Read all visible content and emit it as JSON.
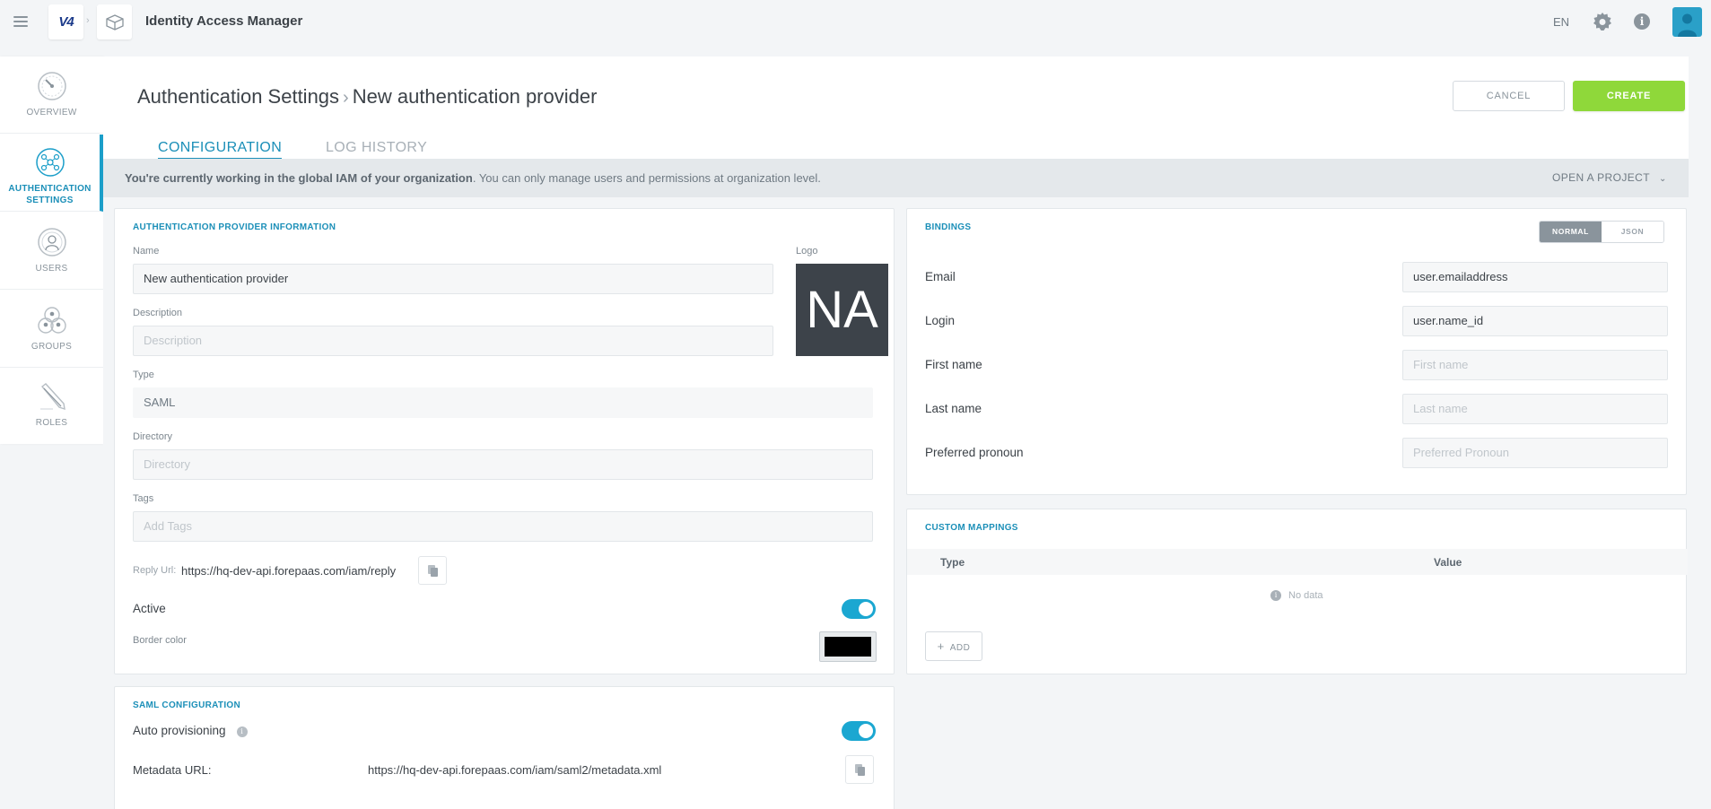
{
  "app": {
    "title": "Identity Access Manager",
    "brand": "V4",
    "lang": "EN",
    "colors": {
      "accent": "#1b8fb8",
      "create": "#8fd83a",
      "toggle": "#1ba7d1"
    }
  },
  "sidebar": {
    "items": [
      {
        "label": "OVERVIEW",
        "icon": "dashboard-icon"
      },
      {
        "label": "AUTHENTICATION SETTINGS",
        "icon": "network-icon",
        "active": true
      },
      {
        "label": "USERS",
        "icon": "user-icon"
      },
      {
        "label": "GROUPS",
        "icon": "group-icon"
      },
      {
        "label": "ROLES",
        "icon": "pencil-icon"
      }
    ]
  },
  "header": {
    "breadcrumb_root": "Authentication Settings",
    "breadcrumb_current": "New authentication provider",
    "cancel_label": "CANCEL",
    "create_label": "CREATE"
  },
  "tabs": [
    {
      "label": "CONFIGURATION",
      "active": true
    },
    {
      "label": "LOG HISTORY",
      "active": false
    }
  ],
  "notice": {
    "bold": "You're currently working in the global IAM of your organization",
    "rest": ". You can only manage users and permissions at organization level.",
    "open_project": "OPEN A PROJECT"
  },
  "provider_info": {
    "title": "AUTHENTICATION PROVIDER INFORMATION",
    "name_label": "Name",
    "name_value": "New authentication provider",
    "logo_label": "Logo",
    "logo_initials": "NA",
    "description_label": "Description",
    "description_placeholder": "Description",
    "type_label": "Type",
    "type_value": "SAML",
    "directory_label": "Directory",
    "directory_placeholder": "Directory",
    "tags_label": "Tags",
    "tags_placeholder": "Add Tags",
    "reply_url_label": "Reply Url:",
    "reply_url_value": "https://hq-dev-api.forepaas.com/iam/reply",
    "active_label": "Active",
    "active_value": true,
    "border_color_label": "Border color",
    "border_color_value": "#000000"
  },
  "saml": {
    "title": "SAML CONFIGURATION",
    "auto_provisioning_label": "Auto provisioning",
    "auto_provisioning_value": true,
    "metadata_label": "Metadata URL:",
    "metadata_value": "https://hq-dev-api.forepaas.com/iam/saml2/metadata.xml"
  },
  "bindings": {
    "title": "BINDINGS",
    "mode_normal": "NORMAL",
    "mode_json": "JSON",
    "rows": [
      {
        "label": "Email",
        "value": "user.emailaddress",
        "placeholder": ""
      },
      {
        "label": "Login",
        "value": "user.name_id",
        "placeholder": ""
      },
      {
        "label": "First name",
        "value": "",
        "placeholder": "First name"
      },
      {
        "label": "Last name",
        "value": "",
        "placeholder": "Last name"
      },
      {
        "label": "Preferred pronoun",
        "value": "",
        "placeholder": "Preferred Pronoun"
      }
    ]
  },
  "custom_mappings": {
    "title": "CUSTOM MAPPINGS",
    "col_type": "Type",
    "col_value": "Value",
    "empty_text": "No data",
    "add_label": "ADD"
  }
}
